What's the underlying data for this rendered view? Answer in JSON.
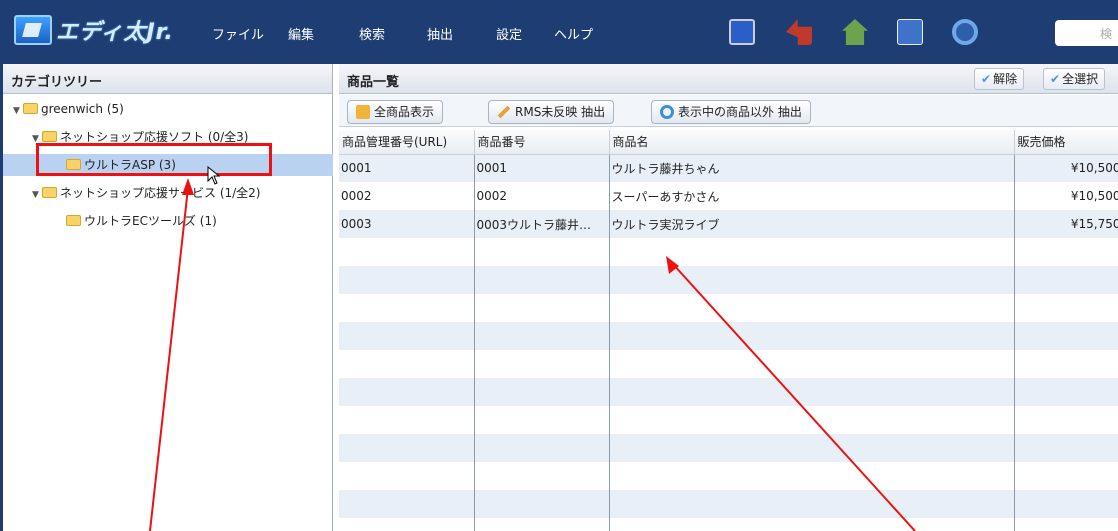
{
  "app": {
    "logo_text": "エディ太Jr."
  },
  "menu": [
    {
      "label": "ファイル"
    },
    {
      "label": "編集"
    },
    {
      "label": "検索"
    },
    {
      "label": "抽出"
    },
    {
      "label": "設定"
    },
    {
      "label": "ヘルプ"
    }
  ],
  "search": {
    "placeholder": "検"
  },
  "tree": {
    "header": "カテゴリツリー",
    "items": [
      {
        "label": "greenwich (5)"
      },
      {
        "label": "ネットショップ応援ソフト (0/全3)"
      },
      {
        "label": "ウルトラASP (3)"
      },
      {
        "label": "ネットショップ応援サービス (1/全2)"
      },
      {
        "label": "ウルトラECツールズ (1)"
      }
    ]
  },
  "product_list": {
    "title": "商品一覧",
    "unselect_label": "解除",
    "select_all_label": "全選択",
    "toolbar": {
      "show_all": "全商品表示",
      "rms_extract": "RMS未反映 抽出",
      "other_extract": "表示中の商品以外 抽出"
    },
    "columns": [
      "商品管理番号(URL)",
      "商品番号",
      "商品名",
      "販売価格"
    ],
    "rows": [
      {
        "manage_no": "0001",
        "item_no": "0001",
        "name": "ウルトラ藤井ちゃん",
        "price": "¥10,500"
      },
      {
        "manage_no": "0002",
        "item_no": "0002",
        "name": "スーパーあすかさん",
        "price": "¥10,500"
      },
      {
        "manage_no": "0003",
        "item_no": "0003ウルトラ藤井…",
        "name": "ウルトラ実況ライブ",
        "price": "¥15,750"
      }
    ]
  },
  "colors": {
    "topbar": "#1d3d73",
    "annotation": "#ee1111",
    "selected_row": "#b9d2f1"
  }
}
